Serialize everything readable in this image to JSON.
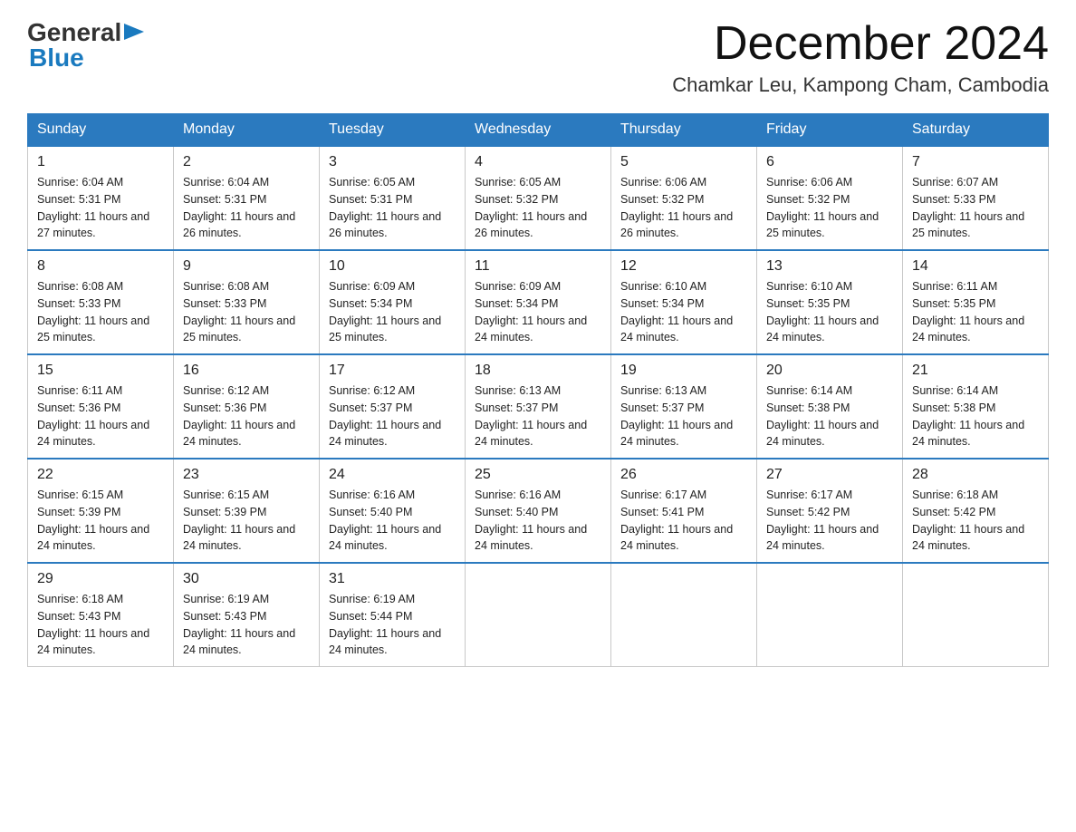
{
  "header": {
    "logo_general": "General",
    "logo_blue": "Blue",
    "title": "December 2024",
    "subtitle": "Chamkar Leu, Kampong Cham, Cambodia"
  },
  "days_of_week": [
    "Sunday",
    "Monday",
    "Tuesday",
    "Wednesday",
    "Thursday",
    "Friday",
    "Saturday"
  ],
  "weeks": [
    [
      {
        "day": "1",
        "sunrise": "6:04 AM",
        "sunset": "5:31 PM",
        "daylight": "11 hours and 27 minutes."
      },
      {
        "day": "2",
        "sunrise": "6:04 AM",
        "sunset": "5:31 PM",
        "daylight": "11 hours and 26 minutes."
      },
      {
        "day": "3",
        "sunrise": "6:05 AM",
        "sunset": "5:31 PM",
        "daylight": "11 hours and 26 minutes."
      },
      {
        "day": "4",
        "sunrise": "6:05 AM",
        "sunset": "5:32 PM",
        "daylight": "11 hours and 26 minutes."
      },
      {
        "day": "5",
        "sunrise": "6:06 AM",
        "sunset": "5:32 PM",
        "daylight": "11 hours and 26 minutes."
      },
      {
        "day": "6",
        "sunrise": "6:06 AM",
        "sunset": "5:32 PM",
        "daylight": "11 hours and 25 minutes."
      },
      {
        "day": "7",
        "sunrise": "6:07 AM",
        "sunset": "5:33 PM",
        "daylight": "11 hours and 25 minutes."
      }
    ],
    [
      {
        "day": "8",
        "sunrise": "6:08 AM",
        "sunset": "5:33 PM",
        "daylight": "11 hours and 25 minutes."
      },
      {
        "day": "9",
        "sunrise": "6:08 AM",
        "sunset": "5:33 PM",
        "daylight": "11 hours and 25 minutes."
      },
      {
        "day": "10",
        "sunrise": "6:09 AM",
        "sunset": "5:34 PM",
        "daylight": "11 hours and 25 minutes."
      },
      {
        "day": "11",
        "sunrise": "6:09 AM",
        "sunset": "5:34 PM",
        "daylight": "11 hours and 24 minutes."
      },
      {
        "day": "12",
        "sunrise": "6:10 AM",
        "sunset": "5:34 PM",
        "daylight": "11 hours and 24 minutes."
      },
      {
        "day": "13",
        "sunrise": "6:10 AM",
        "sunset": "5:35 PM",
        "daylight": "11 hours and 24 minutes."
      },
      {
        "day": "14",
        "sunrise": "6:11 AM",
        "sunset": "5:35 PM",
        "daylight": "11 hours and 24 minutes."
      }
    ],
    [
      {
        "day": "15",
        "sunrise": "6:11 AM",
        "sunset": "5:36 PM",
        "daylight": "11 hours and 24 minutes."
      },
      {
        "day": "16",
        "sunrise": "6:12 AM",
        "sunset": "5:36 PM",
        "daylight": "11 hours and 24 minutes."
      },
      {
        "day": "17",
        "sunrise": "6:12 AM",
        "sunset": "5:37 PM",
        "daylight": "11 hours and 24 minutes."
      },
      {
        "day": "18",
        "sunrise": "6:13 AM",
        "sunset": "5:37 PM",
        "daylight": "11 hours and 24 minutes."
      },
      {
        "day": "19",
        "sunrise": "6:13 AM",
        "sunset": "5:37 PM",
        "daylight": "11 hours and 24 minutes."
      },
      {
        "day": "20",
        "sunrise": "6:14 AM",
        "sunset": "5:38 PM",
        "daylight": "11 hours and 24 minutes."
      },
      {
        "day": "21",
        "sunrise": "6:14 AM",
        "sunset": "5:38 PM",
        "daylight": "11 hours and 24 minutes."
      }
    ],
    [
      {
        "day": "22",
        "sunrise": "6:15 AM",
        "sunset": "5:39 PM",
        "daylight": "11 hours and 24 minutes."
      },
      {
        "day": "23",
        "sunrise": "6:15 AM",
        "sunset": "5:39 PM",
        "daylight": "11 hours and 24 minutes."
      },
      {
        "day": "24",
        "sunrise": "6:16 AM",
        "sunset": "5:40 PM",
        "daylight": "11 hours and 24 minutes."
      },
      {
        "day": "25",
        "sunrise": "6:16 AM",
        "sunset": "5:40 PM",
        "daylight": "11 hours and 24 minutes."
      },
      {
        "day": "26",
        "sunrise": "6:17 AM",
        "sunset": "5:41 PM",
        "daylight": "11 hours and 24 minutes."
      },
      {
        "day": "27",
        "sunrise": "6:17 AM",
        "sunset": "5:42 PM",
        "daylight": "11 hours and 24 minutes."
      },
      {
        "day": "28",
        "sunrise": "6:18 AM",
        "sunset": "5:42 PM",
        "daylight": "11 hours and 24 minutes."
      }
    ],
    [
      {
        "day": "29",
        "sunrise": "6:18 AM",
        "sunset": "5:43 PM",
        "daylight": "11 hours and 24 minutes."
      },
      {
        "day": "30",
        "sunrise": "6:19 AM",
        "sunset": "5:43 PM",
        "daylight": "11 hours and 24 minutes."
      },
      {
        "day": "31",
        "sunrise": "6:19 AM",
        "sunset": "5:44 PM",
        "daylight": "11 hours and 24 minutes."
      },
      null,
      null,
      null,
      null
    ]
  ]
}
